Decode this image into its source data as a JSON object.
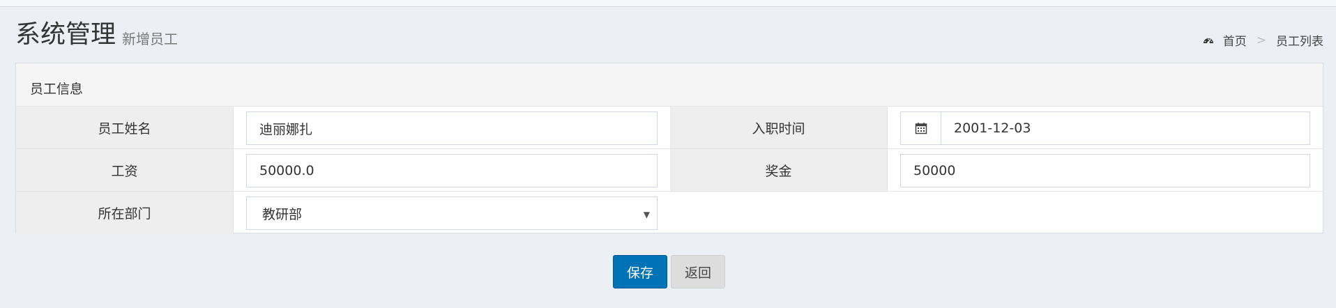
{
  "header": {
    "title": "系统管理",
    "subtitle": "新增员工"
  },
  "breadcrumb": {
    "items": [
      {
        "label": "首页",
        "icon": "dashboard-icon"
      },
      {
        "label": "员工列表"
      }
    ],
    "separator": ">"
  },
  "form": {
    "panel_title": "员工信息",
    "fields": {
      "name": {
        "label": "员工姓名",
        "value": "迪丽娜扎"
      },
      "hire_date": {
        "label": "入职时间",
        "value": "2001-12-03",
        "icon": "calendar-icon"
      },
      "salary": {
        "label": "工资",
        "value": "50000.0"
      },
      "bonus": {
        "label": "奖金",
        "value": "50000"
      },
      "department": {
        "label": "所在部门",
        "selected": "教研部"
      }
    }
  },
  "actions": {
    "save_label": "保存",
    "back_label": "返回"
  },
  "colors": {
    "primary": "#0073b7",
    "background": "#ecf0f5"
  }
}
